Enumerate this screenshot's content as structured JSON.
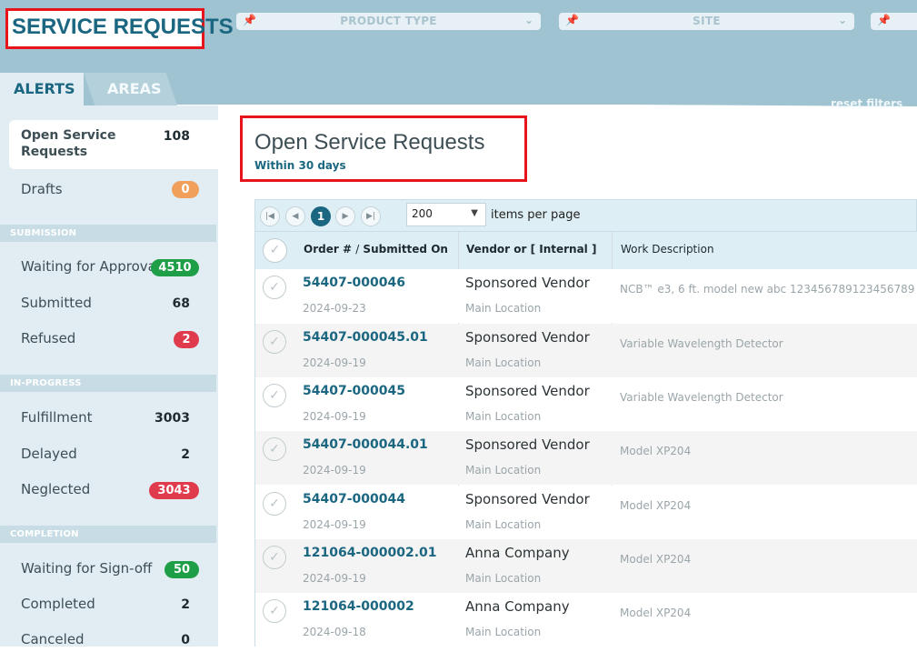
{
  "app": {
    "title": "SERVICE REQUESTS"
  },
  "filters": [
    {
      "label": "PRODUCT TYPE",
      "icon": "pin-icon"
    },
    {
      "label": "SITE",
      "icon": "pin-icon"
    },
    {
      "label": "",
      "icon": "pin-icon"
    }
  ],
  "reset_filters": "reset filters",
  "tabs": {
    "alerts": "ALERTS",
    "areas": "AREAS"
  },
  "sidebar": {
    "open": {
      "label": "Open Service Requests",
      "count": "108"
    },
    "drafts": {
      "label": "Drafts",
      "count": "0"
    },
    "sections": {
      "submission": "SUBMISSION",
      "in_progress": "IN-PROGRESS",
      "completion": "COMPLETION"
    },
    "waiting_approval": {
      "label": "Waiting for Approval",
      "count": "4510"
    },
    "submitted": {
      "label": "Submitted",
      "count": "68"
    },
    "refused": {
      "label": "Refused",
      "count": "2"
    },
    "fulfillment": {
      "label": "Fulfillment",
      "count": "3003"
    },
    "delayed": {
      "label": "Delayed",
      "count": "2"
    },
    "neglected": {
      "label": "Neglected",
      "count": "3043"
    },
    "waiting_signoff": {
      "label": "Waiting for Sign-off",
      "count": "50"
    },
    "completed": {
      "label": "Completed",
      "count": "2"
    },
    "canceled": {
      "label": "Canceled",
      "count": "0"
    }
  },
  "colors": {
    "accent": "#1b6680",
    "green": "#1e9e46",
    "red": "#e03a4d",
    "orange": "#f0a05a"
  },
  "main": {
    "title": "Open Service Requests",
    "subtitle": "Within 30 days"
  },
  "pager": {
    "current_page": "1",
    "page_size": "200",
    "per_page_label": "items per page"
  },
  "grid": {
    "headers": {
      "order": "Order #",
      "sep": "/",
      "submitted": "Submitted On",
      "vendor": "Vendor or [ Internal ]",
      "desc": "Work Description"
    },
    "rows": [
      {
        "order": "54407-000046",
        "date": "2024-09-23",
        "vendor": "Sponsored Vendor",
        "location": "Main Location",
        "desc": "NCB™ e3, 6 ft. model new abc 123456789123456789"
      },
      {
        "order": "54407-000045.01",
        "date": "2024-09-19",
        "vendor": "Sponsored Vendor",
        "location": "Main Location",
        "desc": "Variable Wavelength Detector"
      },
      {
        "order": "54407-000045",
        "date": "2024-09-19",
        "vendor": "Sponsored Vendor",
        "location": "Main Location",
        "desc": "Variable Wavelength Detector"
      },
      {
        "order": "54407-000044.01",
        "date": "2024-09-19",
        "vendor": "Sponsored Vendor",
        "location": "Main Location",
        "desc": "Model XP204"
      },
      {
        "order": "54407-000044",
        "date": "2024-09-19",
        "vendor": "Sponsored Vendor",
        "location": "Main Location",
        "desc": "Model XP204"
      },
      {
        "order": "121064-000002.01",
        "date": "2024-09-19",
        "vendor": "Anna Company",
        "location": "Main Location",
        "desc": "Model XP204"
      },
      {
        "order": "121064-000002",
        "date": "2024-09-18",
        "vendor": "Anna Company",
        "location": "Main Location",
        "desc": "Model XP204"
      }
    ]
  }
}
